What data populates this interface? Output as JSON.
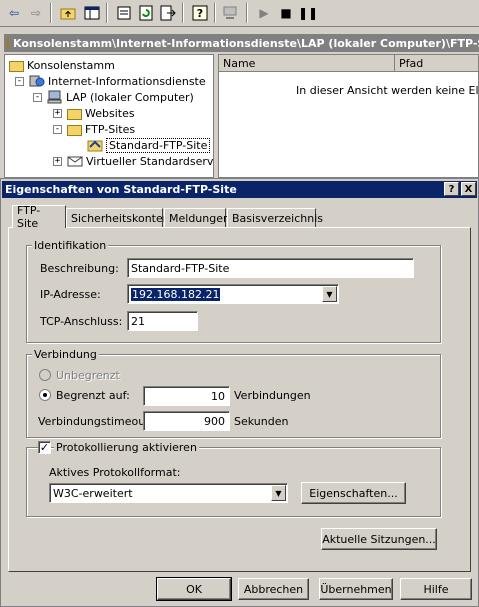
{
  "toolbar": {
    "icons": [
      "back-arrow-icon",
      "forward-arrow-icon",
      "up-folder-icon",
      "show-hide-tree-icon",
      "properties-icon",
      "refresh-icon",
      "export-list-icon",
      "help-icon",
      "computer-icon",
      "play-icon",
      "stop-icon",
      "pause-icon"
    ]
  },
  "console": {
    "path": "Konsolenstamm\\Internet-Informationsdienste\\LAP (lokaler Computer)\\FTP-Sites\\Standard-FTP-Site",
    "tree": {
      "root": "Konsolenstamm",
      "iis": "Internet-Informationsdienste",
      "computer": "LAP (lokaler Computer)",
      "websites": "Websites",
      "ftp_sites": "FTP-Sites",
      "ftp_default": "Standard-FTP-Site",
      "virtual_server": "Virtueller Standardserver"
    },
    "list": {
      "col_name": "Name",
      "col_path": "Pfad",
      "empty_message": "In dieser Ansicht werden keine Elemente angezeigt."
    }
  },
  "dialog": {
    "title": "Eigenschaften von Standard-FTP-Site",
    "help_btn": "?",
    "close_btn": "X",
    "tabs": [
      "FTP-Site",
      "Sicherheitskonten",
      "Meldungen",
      "Basisverzeichnis"
    ],
    "identification": {
      "group_label": "Identifikation",
      "description_label": "Beschreibung:",
      "description_value": "Standard-FTP-Site",
      "ip_label": "IP-Adresse:",
      "ip_value": "192.168.182.21",
      "tcp_label": "TCP-Anschluss:",
      "tcp_value": "21"
    },
    "connection": {
      "group_label": "Verbindung",
      "unlimited_label": "Unbegrenzt",
      "limited_label": "Begrenzt auf:",
      "limited_value": "10",
      "limited_unit": "Verbindungen",
      "timeout_label": "Verbindungstimeout:",
      "timeout_value": "900",
      "timeout_unit": "Sekunden"
    },
    "logging": {
      "enable_label": "Protokollierung aktivieren",
      "format_label": "Aktives Protokollformat:",
      "format_value": "W3C-erweitert",
      "properties_btn": "Eigenschaften..."
    },
    "current_sessions_btn": "Aktuelle Sitzungen...",
    "ok_btn": "OK",
    "cancel_btn": "Abbrechen",
    "apply_btn": "Übernehmen",
    "help_button": "Hilfe"
  }
}
